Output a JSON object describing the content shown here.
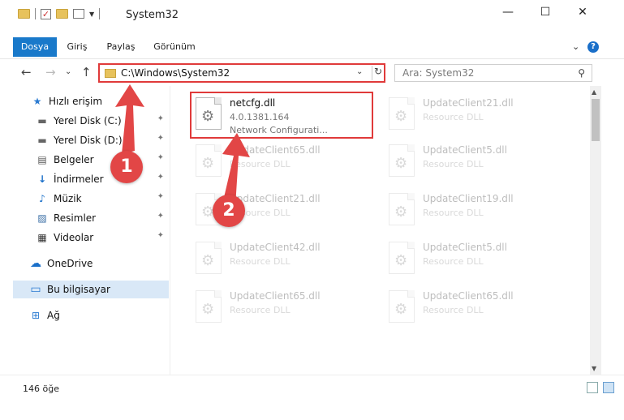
{
  "window": {
    "title": "System32",
    "minimize": "—",
    "maximize": "☐",
    "close": "✕"
  },
  "ribbon": {
    "tabs": [
      "Dosya",
      "Giriş",
      "Paylaş",
      "Görünüm"
    ],
    "expand": "⌄",
    "help": "?"
  },
  "nav": {
    "back": "←",
    "forward": "→",
    "recent": "⌄",
    "up": "↑",
    "address": "C:\\Windows\\System32",
    "address_dropdown": "⌄",
    "refresh": "↻",
    "search_placeholder": "Ara: System32",
    "search_icon": "⚲"
  },
  "sidebar": {
    "items": [
      {
        "label": "Hızlı erişim",
        "icon": "star-icon",
        "glyph": "★",
        "color": "#2a7ad1",
        "pinned": false
      },
      {
        "label": "Yerel Disk (C:)",
        "icon": "drive-icon",
        "glyph": "▬",
        "color": "#666666",
        "pinned": true
      },
      {
        "label": "Yerel Disk (D:)",
        "icon": "drive-icon",
        "glyph": "▬",
        "color": "#666666",
        "pinned": true
      },
      {
        "label": "Belgeler",
        "icon": "documents-icon",
        "glyph": "▤",
        "color": "#555555",
        "pinned": true
      },
      {
        "label": "İndirmeler",
        "icon": "downloads-icon",
        "glyph": "↓",
        "color": "#1a6fc9",
        "pinned": true
      },
      {
        "label": "Müzik",
        "icon": "music-icon",
        "glyph": "♪",
        "color": "#1a6fc9",
        "pinned": true
      },
      {
        "label": "Resimler",
        "icon": "pictures-icon",
        "glyph": "▨",
        "color": "#3a6ea5",
        "pinned": true
      },
      {
        "label": "Videolar",
        "icon": "videos-icon",
        "glyph": "▦",
        "color": "#333333",
        "pinned": true
      },
      {
        "label": "OneDrive",
        "icon": "onedrive-icon",
        "glyph": "☁",
        "color": "#1a6fc9",
        "pinned": false
      },
      {
        "label": "Bu bilgisayar",
        "icon": "computer-icon",
        "glyph": "▭",
        "color": "#2a7ad1",
        "pinned": false
      },
      {
        "label": "Ağ",
        "icon": "network-icon",
        "glyph": "⊞",
        "color": "#2a7ad1",
        "pinned": false
      }
    ],
    "pin_glyph": "📌"
  },
  "files": [
    {
      "name": "netcfg.dll",
      "line1": "4.0.1381.164",
      "line2": "Network Configurati...",
      "highlighted": true
    },
    {
      "name": "UpdateClient21.dll",
      "line1": "Resource DLL",
      "line2": "",
      "highlighted": false
    },
    {
      "name": "UpdateClient65.dll",
      "line1": "Resource DLL",
      "line2": "",
      "highlighted": false
    },
    {
      "name": "UpdateClient5.dll",
      "line1": "Resource DLL",
      "line2": "",
      "highlighted": false
    },
    {
      "name": "UpdateClient21.dll",
      "line1": "Resource DLL",
      "line2": "",
      "highlighted": false
    },
    {
      "name": "UpdateClient19.dll",
      "line1": "Resource DLL",
      "line2": "",
      "highlighted": false
    },
    {
      "name": "UpdateClient42.dll",
      "line1": "Resource DLL",
      "line2": "",
      "highlighted": false
    },
    {
      "name": "UpdateClient5.dll",
      "line1": "Resource DLL",
      "line2": "",
      "highlighted": false
    },
    {
      "name": "UpdateClient65.dll",
      "line1": "Resource DLL",
      "line2": "",
      "highlighted": false
    },
    {
      "name": "UpdateClient65.dll",
      "line1": "Resource DLL",
      "line2": "",
      "highlighted": false
    }
  ],
  "status": {
    "count": "146 öğe"
  },
  "annotations": {
    "step1": "1",
    "step2": "2",
    "highlight_color": "#e03a3a"
  }
}
